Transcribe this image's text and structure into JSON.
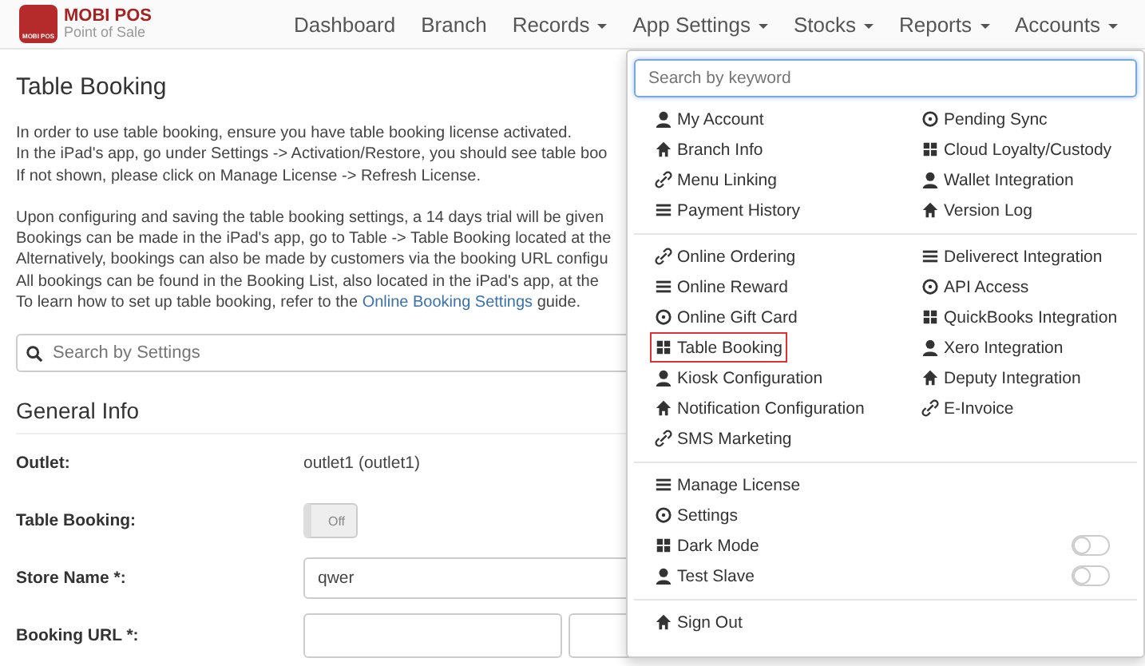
{
  "brand": {
    "name": "MOBI POS",
    "tagline": "Point of Sale",
    "badge": "MOBI POS"
  },
  "nav": [
    {
      "label": "Dashboard",
      "caret": false
    },
    {
      "label": "Branch",
      "caret": false
    },
    {
      "label": "Records",
      "caret": true
    },
    {
      "label": "App Settings",
      "caret": true
    },
    {
      "label": "Stocks",
      "caret": true
    },
    {
      "label": "Reports",
      "caret": true
    },
    {
      "label": "Accounts",
      "caret": true
    }
  ],
  "page": {
    "title": "Table Booking",
    "intro": [
      "In order to use table booking, ensure you have table booking license activated.",
      "In the iPad's app, go under Settings -> Activation/Restore, you should see table boo",
      "If not shown, please click on Manage License -> Refresh License."
    ],
    "details": [
      "Upon configuring and saving the table booking settings, a 14 days trial will be given",
      "Bookings can be made in the iPad's app, go to Table -> Table Booking located at the",
      "Alternatively, bookings can also be made by customers via the booking URL configu",
      "All bookings can be found in the Booking List, also located in the iPad's app, at the"
    ],
    "guide": {
      "before": "To learn how to set up table booking, refer to the ",
      "link": "Online Booking Settings",
      "after": " guide."
    },
    "search": {
      "placeholder": "Search by Settings"
    },
    "section_title": "General Info",
    "fields": [
      {
        "kind": "text",
        "label": "Outlet:",
        "value": "outlet1 (outlet1)"
      },
      {
        "kind": "switch",
        "label": "Table Booking:",
        "value": "Off",
        "on": false
      },
      {
        "kind": "input",
        "label": "Store Name *:",
        "value": "qwer"
      },
      {
        "kind": "url",
        "label": "Booking URL *:"
      }
    ]
  },
  "menu": {
    "search": {
      "placeholder": "Search by keyword"
    },
    "sections": [
      {
        "left": [
          {
            "label": "My Account",
            "selected": false
          },
          {
            "label": "Branch Info",
            "selected": false
          },
          {
            "label": "Menu Linking",
            "selected": false
          },
          {
            "label": "Payment History",
            "selected": false
          }
        ],
        "right": [
          {
            "label": "Pending Sync",
            "selected": false
          },
          {
            "label": "Cloud Loyalty/Custody",
            "selected": false
          },
          {
            "label": "Wallet Integration",
            "selected": false
          },
          {
            "label": "Version Log",
            "selected": false
          }
        ]
      },
      {
        "left": [
          {
            "label": "Online Ordering",
            "selected": false
          },
          {
            "label": "Online Reward",
            "selected": false
          },
          {
            "label": "Online Gift Card",
            "selected": false
          },
          {
            "label": "Table Booking",
            "selected": true
          },
          {
            "label": "Kiosk Configuration",
            "selected": false
          },
          {
            "label": "Notification Configuration",
            "selected": false
          },
          {
            "label": "SMS Marketing",
            "selected": false
          }
        ],
        "right": [
          {
            "label": "Deliverect Integration",
            "selected": false
          },
          {
            "label": "API Access",
            "selected": false
          },
          {
            "label": "QuickBooks Integration",
            "selected": false
          },
          {
            "label": "Xero Integration",
            "selected": false
          },
          {
            "label": "Deputy Integration",
            "selected": false
          },
          {
            "label": "E-Invoice",
            "selected": false
          }
        ]
      },
      {
        "left": [
          {
            "label": "Manage License",
            "selected": false
          },
          {
            "label": "Settings",
            "selected": false
          },
          {
            "label": "Dark Mode",
            "selected": false,
            "toggle": {
              "on": false
            }
          },
          {
            "label": "Test Slave",
            "selected": false,
            "toggle": {
              "on": false
            }
          }
        ]
      },
      {
        "left": [
          {
            "label": "Sign Out",
            "selected": false
          }
        ]
      }
    ]
  }
}
